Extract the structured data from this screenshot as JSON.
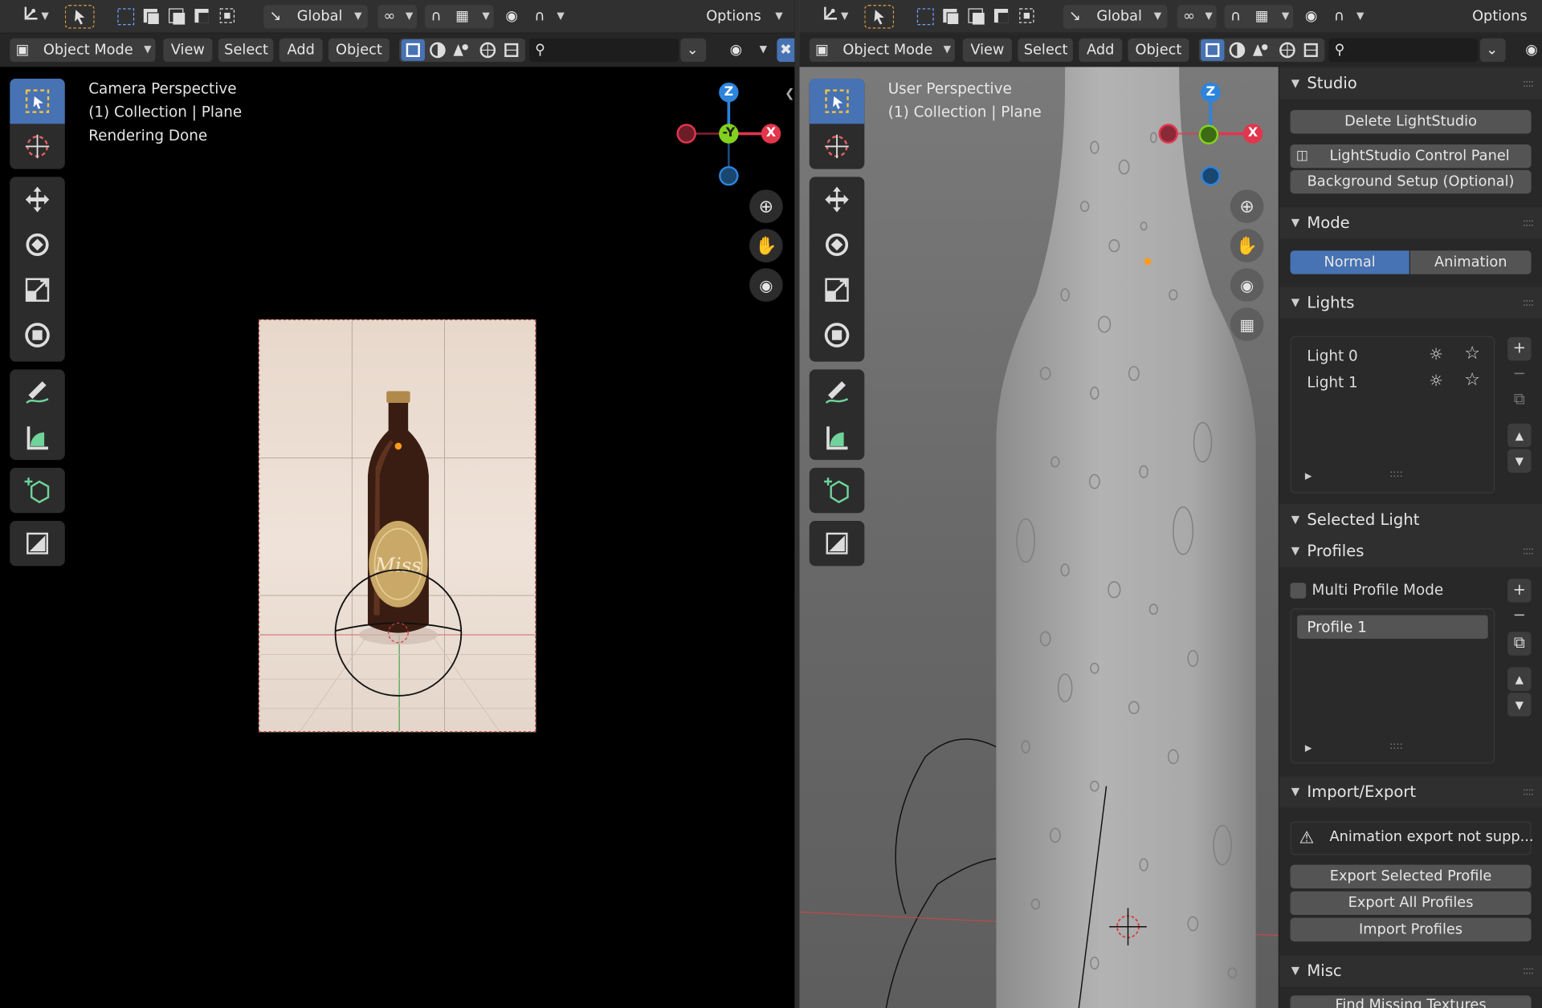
{
  "left_header": {
    "transform_label": "Global",
    "options_label": "Options",
    "mode_label": "Object Mode",
    "menu": [
      "View",
      "Select",
      "Add",
      "Object"
    ]
  },
  "right_header": {
    "transform_label": "Global",
    "options_label": "Options",
    "mode_label": "Object Mode",
    "menu": [
      "View",
      "Select",
      "Add",
      "Object"
    ]
  },
  "left_viewport": {
    "lines": [
      "Camera Perspective",
      "(1) Collection | Plane",
      "Rendering Done"
    ],
    "render_label": "Miss"
  },
  "right_viewport": {
    "lines": [
      "User Perspective",
      "(1) Collection | Plane"
    ]
  },
  "gizmo_left": {
    "z": "Z",
    "y": "-Y",
    "x": "X"
  },
  "gizmo_right": {
    "z": "Z",
    "x": "X"
  },
  "axis_colors": {
    "x": "#e1364c",
    "y": "#82d11e",
    "z": "#2d84dc"
  },
  "panel": {
    "studio": {
      "title": "Studio",
      "delete_btn": "Delete LightStudio",
      "control_panel_btn": "LightStudio Control Panel",
      "background_btn": "Background Setup (Optional)"
    },
    "mode": {
      "title": "Mode",
      "options": [
        "Normal",
        "Animation"
      ],
      "selected": "Normal"
    },
    "lights": {
      "title": "Lights",
      "items": [
        "Light 0",
        "Light 1"
      ]
    },
    "selected_light": {
      "title": "Selected Light"
    },
    "profiles": {
      "title": "Profiles",
      "multi_label": "Multi Profile Mode",
      "multi_checked": false,
      "items": [
        "Profile 1"
      ]
    },
    "import_export": {
      "title": "Import/Export",
      "warning": "Animation export not supp...",
      "buttons": [
        "Export Selected Profile",
        "Export All Profiles",
        "Import Profiles"
      ]
    },
    "misc": {
      "title": "Misc",
      "find_btn": "Find Missing Textures"
    }
  },
  "colors": {
    "accent": "#4772b3",
    "header": "#303030",
    "panel": "#282828"
  }
}
